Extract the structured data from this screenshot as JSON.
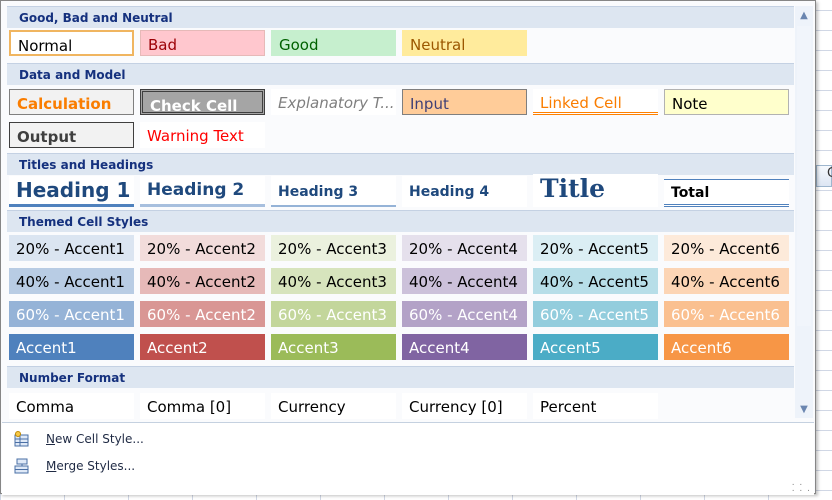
{
  "sections": [
    {
      "title": "Good, Bad and Neutral",
      "cells": [
        {
          "label": "Normal",
          "bg": "#ffffff",
          "fg": "#000000",
          "border": "2px solid #f0b560",
          "italic": false,
          "bold": false
        },
        {
          "label": "Bad",
          "bg": "#ffc7ce",
          "fg": "#9c0006",
          "border": "1px solid #e6b9b8",
          "italic": false,
          "bold": false
        },
        {
          "label": "Good",
          "bg": "#c6efce",
          "fg": "#006100",
          "border": "1px solid #c6efce",
          "italic": false,
          "bold": false
        },
        {
          "label": "Neutral",
          "bg": "#ffeb9c",
          "fg": "#9c5700",
          "border": "1px solid #ffeb9c",
          "italic": false,
          "bold": false
        }
      ]
    },
    {
      "title": "Data and Model",
      "cells": [
        {
          "label": "Calculation",
          "bg": "#f2f2f2",
          "fg": "#fa7d00",
          "border": "1px solid #7f7f7f",
          "bold": true
        },
        {
          "label": "Check Cell",
          "bg": "#a5a5a5",
          "fg": "#ffffff",
          "border": "3px double #3f3f3f",
          "bold": true
        },
        {
          "label": "Explanatory T...",
          "bg": "#ffffff",
          "fg": "#7f7f7f",
          "border": "none",
          "italic": true
        },
        {
          "label": "Input",
          "bg": "#ffcc99",
          "fg": "#3f3f76",
          "border": "1px solid #7f7f7f"
        },
        {
          "label": "Linked Cell",
          "bg": "#ffffff",
          "fg": "#fa7d00",
          "border": "none",
          "underline": "3px double #ff8001"
        },
        {
          "label": "Note",
          "bg": "#ffffcc",
          "fg": "#000000",
          "border": "1px solid #b2b2b2"
        },
        {
          "label": "Output",
          "bg": "#f2f2f2",
          "fg": "#3f3f3f",
          "border": "1px solid #3f3f3f",
          "bold": true
        },
        {
          "label": "Warning Text",
          "bg": "#ffffff",
          "fg": "#ff0000",
          "border": "none"
        }
      ]
    },
    {
      "title": "Titles and Headings",
      "cells": [
        {
          "label": "Heading 1",
          "fg": "#1f497d",
          "size": "20px",
          "bold": true,
          "underline": "3px solid #4f81bd"
        },
        {
          "label": "Heading 2",
          "fg": "#1f497d",
          "size": "17px",
          "bold": true,
          "underline": "3px solid #a7bfde"
        },
        {
          "label": "Heading 3",
          "fg": "#1f497d",
          "size": "14px",
          "bold": true,
          "underline": "2px solid #95b3d7"
        },
        {
          "label": "Heading 4",
          "fg": "#1f497d",
          "size": "14px",
          "bold": true,
          "underline": "none"
        },
        {
          "label": "Title",
          "fg": "#1f497d",
          "size": "25px",
          "bold": true,
          "serif": true,
          "underline": "none"
        },
        {
          "label": "Total",
          "fg": "#000000",
          "size": "14px",
          "bold": true,
          "topline": "1px solid #4f81bd",
          "underline": "3px double #4f81bd"
        }
      ]
    },
    {
      "title": "Themed Cell Styles",
      "rows": [
        [
          {
            "label": "20% - Accent1",
            "bg": "#dbe5f1",
            "fg": "#000000"
          },
          {
            "label": "20% - Accent2",
            "bg": "#f2dcdb",
            "fg": "#000000"
          },
          {
            "label": "20% - Accent3",
            "bg": "#ebf1de",
            "fg": "#000000"
          },
          {
            "label": "20% - Accent4",
            "bg": "#e5e0ec",
            "fg": "#000000"
          },
          {
            "label": "20% - Accent5",
            "bg": "#dbeef4",
            "fg": "#000000"
          },
          {
            "label": "20% - Accent6",
            "bg": "#fdeada",
            "fg": "#000000"
          }
        ],
        [
          {
            "label": "40% - Accent1",
            "bg": "#b8cce4",
            "fg": "#000000"
          },
          {
            "label": "40% - Accent2",
            "bg": "#e6b9b8",
            "fg": "#000000"
          },
          {
            "label": "40% - Accent3",
            "bg": "#d7e4bd",
            "fg": "#000000"
          },
          {
            "label": "40% - Accent4",
            "bg": "#ccc1da",
            "fg": "#000000"
          },
          {
            "label": "40% - Accent5",
            "bg": "#b7dee8",
            "fg": "#000000"
          },
          {
            "label": "40% - Accent6",
            "bg": "#fcd5b5",
            "fg": "#000000"
          }
        ],
        [
          {
            "label": "60% - Accent1",
            "bg": "#95b3d7",
            "fg": "#ffffff"
          },
          {
            "label": "60% - Accent2",
            "bg": "#d99694",
            "fg": "#ffffff"
          },
          {
            "label": "60% - Accent3",
            "bg": "#c3d69b",
            "fg": "#ffffff"
          },
          {
            "label": "60% - Accent4",
            "bg": "#b3a2c7",
            "fg": "#ffffff"
          },
          {
            "label": "60% - Accent5",
            "bg": "#93cddd",
            "fg": "#ffffff"
          },
          {
            "label": "60% - Accent6",
            "bg": "#fac090",
            "fg": "#ffffff"
          }
        ],
        [
          {
            "label": "Accent1",
            "bg": "#4f81bd",
            "fg": "#ffffff"
          },
          {
            "label": "Accent2",
            "bg": "#c0504d",
            "fg": "#ffffff"
          },
          {
            "label": "Accent3",
            "bg": "#9bbb59",
            "fg": "#ffffff"
          },
          {
            "label": "Accent4",
            "bg": "#8064a2",
            "fg": "#ffffff"
          },
          {
            "label": "Accent5",
            "bg": "#4bacc6",
            "fg": "#ffffff"
          },
          {
            "label": "Accent6",
            "bg": "#f79646",
            "fg": "#ffffff"
          }
        ]
      ]
    },
    {
      "title": "Number Format",
      "cells": [
        {
          "label": "Comma"
        },
        {
          "label": "Comma [0]"
        },
        {
          "label": "Currency"
        },
        {
          "label": "Currency [0]"
        },
        {
          "label": "Percent"
        }
      ]
    }
  ],
  "menu": {
    "new_cell_style": "New Cell Style...",
    "merge_styles": "Merge Styles..."
  },
  "background_column_letter": "C"
}
